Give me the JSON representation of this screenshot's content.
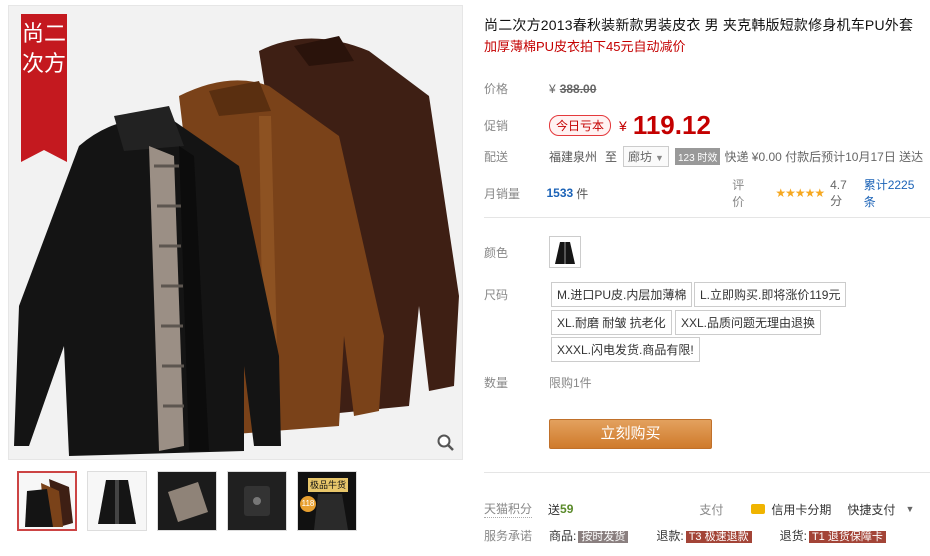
{
  "gallery": {
    "brand_tag": "尚二次方",
    "zoom_icon": "magnifier-icon",
    "thumbnail_badge": "极品牛货",
    "thumbnail_price": "118"
  },
  "product": {
    "title": "尚二次方2013春秋装新款男装皮衣 男 夹克韩版短款修身机车PU外套",
    "promo": "加厚薄棉PU皮衣拍下45元自动减价"
  },
  "price": {
    "label": "价格",
    "currency": "¥",
    "original": "388.00"
  },
  "promotion": {
    "label": "促销",
    "badge": "今日亏本",
    "currency": "¥",
    "value": "119.12"
  },
  "shipping": {
    "label": "配送",
    "from": "福建泉州",
    "to_label": "至",
    "to_select": "廊坊",
    "time_badge": "123 时效",
    "express": "快递 ¥0.00 付款后预计10月17日 送达"
  },
  "sales": {
    "label": "月销量",
    "count": "1533",
    "unit": "件",
    "rating_label": "评价",
    "stars": "★★★★★",
    "score": "4.7分",
    "reviews": "累计2225条"
  },
  "color": {
    "label": "颜色"
  },
  "size": {
    "label": "尺码",
    "options": [
      "M.进口PU皮.内层加薄棉",
      "L.立即购买.即将涨价119元",
      "XL.耐磨 耐皱 抗老化",
      "XXL.品质问题无理由退换",
      "XXXL.闪电发货.商品有限!"
    ]
  },
  "quantity": {
    "label": "数量",
    "limit": "限购1件"
  },
  "buy_button": "立刻购买",
  "points": {
    "label": "天猫积分",
    "send": "送",
    "value": "59",
    "pay_label": "支付",
    "credit": "信用卡分期",
    "quick_pay": "快捷支付"
  },
  "service": {
    "label": "服务承诺",
    "item1_label": "商品:",
    "item1_tag": "按时发货",
    "item2_label": "退款:",
    "item2_tag": "T3 极速退款",
    "item3_label": "退货:",
    "item3_tag": "T1 退货保障卡"
  },
  "colors": {
    "accent": "#c40000",
    "buy_button": "#d98a3a",
    "link": "#1c63b7"
  }
}
